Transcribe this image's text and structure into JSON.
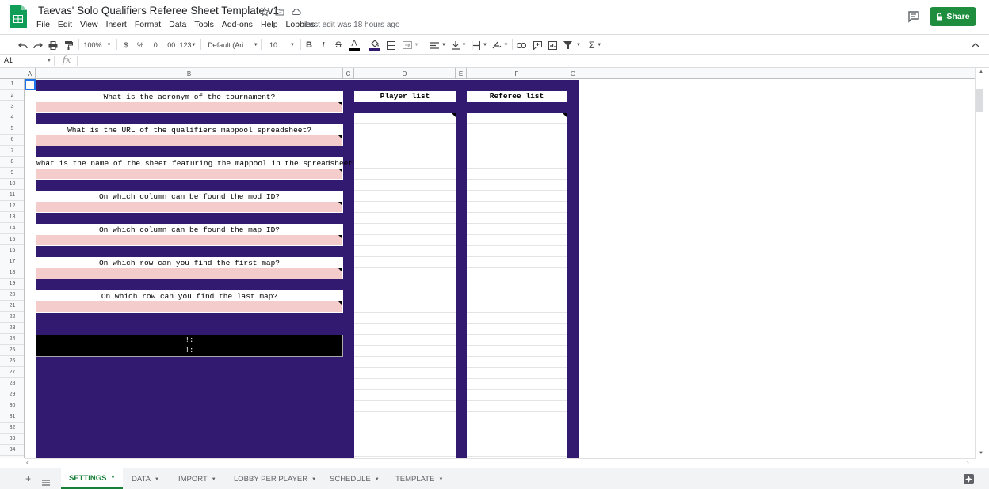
{
  "doc": {
    "title": "Taevas' Solo Qualifiers Referee Sheet Template v1",
    "last_edit": "Last edit was 18 hours ago"
  },
  "menu": [
    "File",
    "Edit",
    "View",
    "Insert",
    "Format",
    "Data",
    "Tools",
    "Add-ons",
    "Help",
    "Lobbies"
  ],
  "share_label": "Share",
  "toolbar": {
    "zoom": "100%",
    "currency": "$",
    "percent": "%",
    "dec_decrease": ".0",
    "dec_increase": ".00",
    "more_formats": "123",
    "font": "Default (Ari...",
    "font_size": "10",
    "bold": "B",
    "italic": "I",
    "strike": "S",
    "text_color_glyph": "A",
    "sum_glyph": "Σ"
  },
  "name_box": "A1",
  "fx_label": "fx",
  "columns": [
    "A",
    "B",
    "C",
    "D",
    "E",
    "F",
    "G"
  ],
  "rows": [
    "1",
    "2",
    "3",
    "4",
    "5",
    "6",
    "7",
    "8",
    "9",
    "10",
    "11",
    "12",
    "13",
    "14",
    "15",
    "16",
    "17",
    "18",
    "19",
    "20",
    "21",
    "22",
    "23",
    "24",
    "25",
    "26",
    "27",
    "28",
    "29",
    "30",
    "31",
    "32",
    "33",
    "34"
  ],
  "questions": [
    "What is the acronym of the tournament?",
    "What is the URL of the qualifiers mappool spreadsheet?",
    "What is the name of the sheet featuring the mappool in the spreadsheet?",
    "On which column can be found the mod ID?",
    "On which column can be found the map ID?",
    "On which row can you find the first map?",
    "On which row can you find the last map?"
  ],
  "errors": [
    "!:",
    "!:"
  ],
  "lists": {
    "players": "Player list",
    "referees": "Referee list"
  },
  "tabs": [
    "SETTINGS",
    "DATA",
    "IMPORT",
    "LOBBY PER PLAYER",
    "SCHEDULE",
    "TEMPLATE"
  ],
  "colors": {
    "background": "#331a71",
    "answer": "#f4cccc",
    "share": "#1e8e3e",
    "active_tab": "#188038"
  }
}
